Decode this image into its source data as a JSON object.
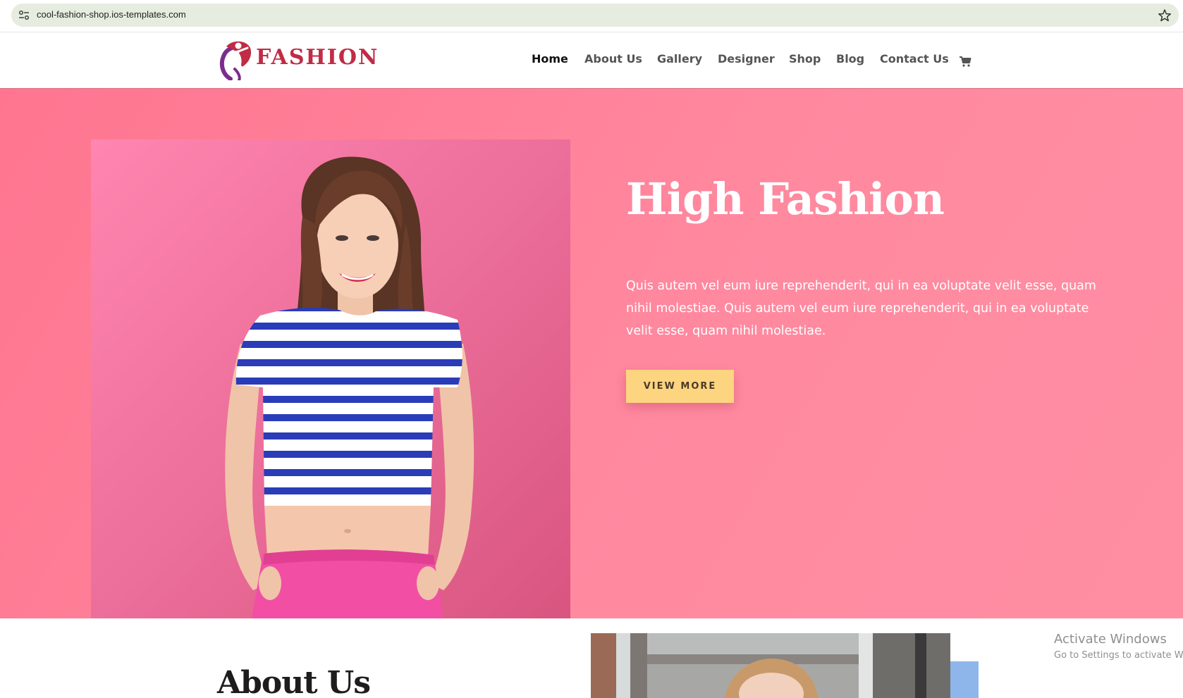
{
  "browser": {
    "url": "cool-fashion-shop.ios-templates.com",
    "site_info_icon": "tune-icon",
    "bookmark_icon": "star-icon"
  },
  "site": {
    "logo_text": "FASHION",
    "logo_icon": "dancer-logo-icon",
    "nav": [
      {
        "label": "Home",
        "active": true
      },
      {
        "label": "About Us",
        "active": false
      },
      {
        "label": "Gallery",
        "active": false
      },
      {
        "label": "Designer",
        "active": false
      },
      {
        "label": "Shop",
        "active": false
      },
      {
        "label": "Blog",
        "active": false
      },
      {
        "label": "Contact Us",
        "active": false
      }
    ],
    "cart_icon": "cart-icon"
  },
  "hero": {
    "title": "High Fashion",
    "text": "Quis autem vel eum iure reprehenderit, qui in ea voluptate velit esse, quam nihil molestiae. Quis autem vel eum iure reprehenderit, qui in ea voluptate velit esse, quam nihil molestiae.",
    "button_label": "VIEW MORE"
  },
  "about": {
    "title": "About Us"
  },
  "watermark": {
    "title": "Activate Windows",
    "subtitle": "Go to Settings to activate W"
  },
  "colors": {
    "hero_background": "#ff7f96",
    "button": "#fdd47f",
    "logo_red": "#c12b45",
    "logo_purple": "#7b2d8e",
    "accent_blue": "#8eb6ea"
  }
}
